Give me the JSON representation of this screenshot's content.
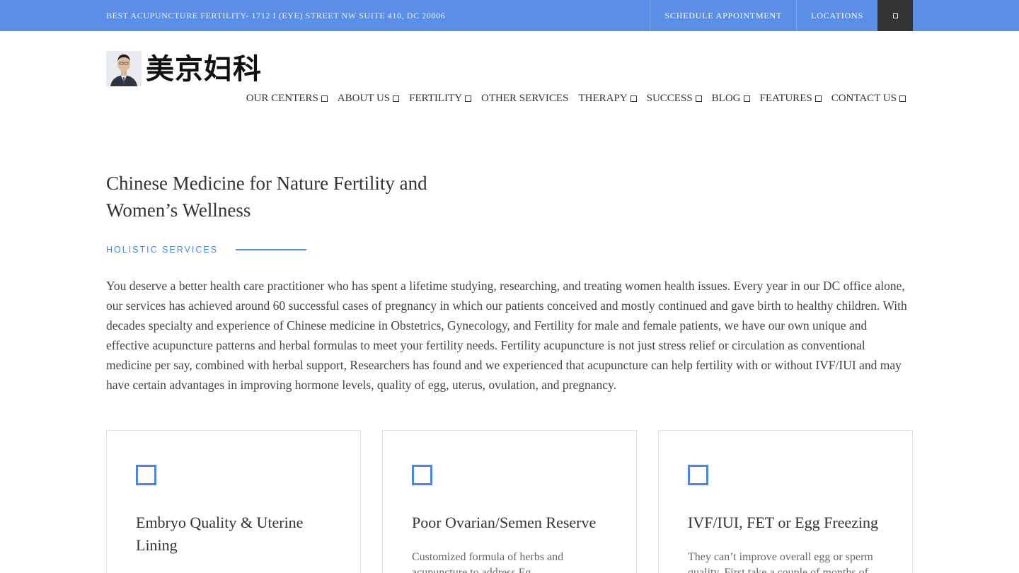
{
  "topbar": {
    "address": "BEST ACUPUNCTURE FERTILITY- 1712 I (EYE) STREET NW SUITE 410, DC 20006",
    "schedule_label": "SCHEDULE APPOINTMENT",
    "locations_label": "LOCATIONS",
    "menu_icon": "square-icon",
    "bg_color": "#5b8ee6"
  },
  "logo": {
    "chinese_text": "美京妇科",
    "photo": "doctor-portrait"
  },
  "nav": {
    "items": [
      {
        "label": "OUR CENTERS",
        "has_dropdown": true
      },
      {
        "label": "ABOUT US",
        "has_dropdown": true
      },
      {
        "label": "FERTILITY",
        "has_dropdown": true
      },
      {
        "label": "OTHER SERVICES",
        "has_dropdown": false
      },
      {
        "label": "THERAPY",
        "has_dropdown": true
      },
      {
        "label": "SUCCESS",
        "has_dropdown": true
      },
      {
        "label": "BLOG",
        "has_dropdown": true
      },
      {
        "label": "FEATURES",
        "has_dropdown": true
      },
      {
        "label": "CONTACT US",
        "has_dropdown": true
      }
    ]
  },
  "hero": {
    "title": "Chinese Medicine for Nature Fertility and Women’s Wellness",
    "subtitle": "HOLISTIC SERVICES",
    "accent_color": "#4a86d9",
    "intro": "You deserve a better health care practitioner who has spent a lifetime studying, researching, and treating women health issues. Every year in our DC office alone, our services has achieved around 60 successful cases of pregnancy in which our patients conceived and mostly continued and gave birth to healthy children. With decades specialty and experience of Chinese medicine in Obstetrics, Gynecology, and Fertility for male and female patients, we have our own unique and effective acupuncture patterns and herbal formulas to meet your fertility needs. Fertility acupuncture is not just stress relief or circulation as conventional medicine per say, combined with herbal support, Researchers has found and we experienced that acupuncture can help fertility with or without IVF/IUI and may have certain advantages in improving hormone levels, quality of egg, uterus, ovulation, and pregnancy."
  },
  "cards": [
    {
      "icon": "square-icon",
      "title": "Embryo Quality & Uterine Lining",
      "text": ""
    },
    {
      "icon": "square-icon",
      "title": "Poor Ovarian/Semen Reserve",
      "text": "Customized formula of herbs and acupuncture to address Eg"
    },
    {
      "icon": "square-icon",
      "title": "IVF/IUI, FET or Egg Freezing",
      "text": "They can’t improve overall egg or sperm quality. First take a couple of months of"
    }
  ]
}
